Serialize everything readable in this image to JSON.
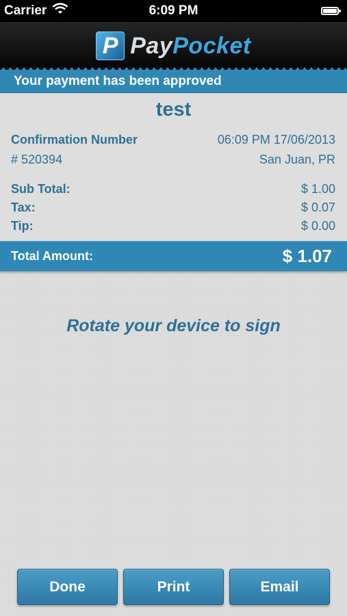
{
  "status_bar": {
    "carrier": "Carrier",
    "time": "6:09 PM",
    "battery_level": 1.0
  },
  "header": {
    "logo_letter": "P",
    "brand_part1": "Pay",
    "brand_part2": "Pocket"
  },
  "banner": {
    "message": "Your payment has been approved"
  },
  "receipt": {
    "merchant": "test",
    "confirmation_label": "Confirmation Number",
    "datetime": "06:09 PM 17/06/2013",
    "confirmation_number": "# 520394",
    "location": "San Juan, PR",
    "subtotal_label": "Sub Total:",
    "subtotal_value": "$ 1.00",
    "tax_label": "Tax:",
    "tax_value": "$ 0.07",
    "tip_label": "Tip:",
    "tip_value": "$ 0.00",
    "total_label": "Total Amount:",
    "total_value": "$ 1.07"
  },
  "signature": {
    "prompt": "Rotate your device to sign"
  },
  "actions": {
    "done": "Done",
    "print": "Print",
    "email": "Email"
  },
  "colors": {
    "accent": "#2f87b5",
    "text": "#2f6f96",
    "background": "#dcdcdc"
  },
  "icons": {
    "wifi": "wifi-icon",
    "battery": "battery-icon",
    "logo": "paypocket-logo-icon"
  }
}
